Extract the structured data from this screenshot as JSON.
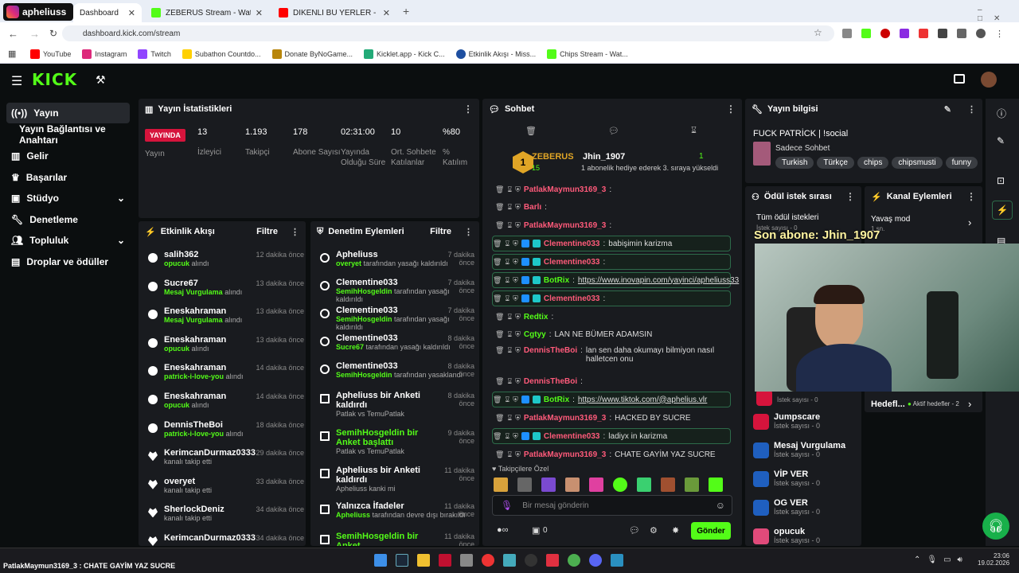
{
  "browser": {
    "tabs": [
      {
        "label": "Dashboard"
      },
      {
        "label": "ZEBERUS Stream - Watch Live o"
      },
      {
        "label": "DİKENLİ BU YERLER - YouTube"
      }
    ],
    "profile_overlay": "apheliuss",
    "url": "dashboard.kick.com/stream",
    "bookmarks": [
      "YouTube",
      "Instagram",
      "Twitch",
      "Subathon Countdo...",
      "Donate ByNoGame...",
      "Kicklet.app - Kick C...",
      "Etkinlik Akışı - Miss...",
      "Chips Stream - Wat..."
    ]
  },
  "sidebar": {
    "items": [
      {
        "label": "Yayın"
      },
      {
        "label": "Yayın Bağlantısı ve Anahtarı"
      },
      {
        "label": "Gelir"
      },
      {
        "label": "Başarılar"
      },
      {
        "label": "Stüdyo"
      },
      {
        "label": "Denetleme"
      },
      {
        "label": "Topluluk"
      },
      {
        "label": "Droplar ve ödüller"
      }
    ]
  },
  "stats": {
    "title": "Yayın İstatistikleri",
    "live_badge": "YAYINDA",
    "live_label": "Yayın",
    "items": [
      {
        "value": "13",
        "label": "İzleyici"
      },
      {
        "value": "1.193",
        "label": "Takipçi"
      },
      {
        "value": "178",
        "label": "Abone Sayısı"
      },
      {
        "value": "02:31:00",
        "label": "Yayında Olduğu Süre"
      },
      {
        "value": "10",
        "label": "Ort. Sohbete Katılanlar"
      },
      {
        "value": "%80",
        "label": "% Katılım"
      }
    ]
  },
  "activity": {
    "title": "Etkinlik Akışı",
    "filter": "Filtre",
    "items": [
      {
        "name": "salih362",
        "sub_hl": "opucuk",
        "sub": " alındı",
        "time": "12 dakika önce"
      },
      {
        "name": "Sucre67",
        "sub_hl": "Mesaj Vurgulama",
        "sub": " alındı",
        "time": "13 dakika önce"
      },
      {
        "name": "Eneskahraman",
        "sub_hl": "Mesaj Vurgulama",
        "sub": " alındı",
        "time": "13 dakika önce"
      },
      {
        "name": "Eneskahraman",
        "sub_hl": "opucuk",
        "sub": " alındı",
        "time": "13 dakika önce"
      },
      {
        "name": "Eneskahraman",
        "sub_hl": "patrick-i-love-you",
        "sub": " alındı",
        "time": "14 dakika önce"
      },
      {
        "name": "Eneskahraman",
        "sub_hl": "opucuk",
        "sub": " alındı",
        "time": "14 dakika önce"
      },
      {
        "name": "DennisTheBoi",
        "sub_hl": "patrick-i-love-you",
        "sub": " alındı",
        "time": "18 dakika önce"
      },
      {
        "name": "KerimcanDurmaz0333",
        "sub_hl": "",
        "sub": "kanalı takip etti",
        "time": "29 dakika önce"
      },
      {
        "name": "overyet",
        "sub_hl": "",
        "sub": "kanalı takip etti",
        "time": "33 dakika önce"
      },
      {
        "name": "SherlockDeniz",
        "sub_hl": "",
        "sub": "kanalı takip etti",
        "time": "34 dakika önce"
      },
      {
        "name": "KerimcanDurmaz0333",
        "sub_hl": "",
        "sub": "",
        "time": "34 dakika önce"
      }
    ]
  },
  "moderation": {
    "title": "Denetim Eylemleri",
    "filter": "Filtre",
    "items": [
      {
        "name": "Apheliuss",
        "sub_hl": "overyet",
        "sub": " tarafından yasağı kaldırıldı",
        "time": "7 dakika önce"
      },
      {
        "name": "Clementine033",
        "sub_hl": "SemihHosgeldin",
        "sub": " tarafından yasağı kaldırıldı",
        "time": "7 dakika önce"
      },
      {
        "name": "Clementine033",
        "sub_hl": "SemihHosgeldin",
        "sub": " tarafından yasağı kaldırıldı",
        "time": "7 dakika önce"
      },
      {
        "name": "Clementine033",
        "sub_hl": "Sucre67",
        "sub": " tarafından yasağı kaldırıldı",
        "time": "8 dakika önce"
      },
      {
        "name": "Clementine033",
        "sub_hl": "SemihHosgeldin",
        "sub": " tarafından yasaklandı",
        "time": "8 dakika önce"
      },
      {
        "name": "Apheliuss bir Anketi kaldırdı",
        "sub_hl": "",
        "sub": "Patlak vs TemuPatlak",
        "time": "8 dakika önce"
      },
      {
        "name": "SemihHosgeldin bir Anket başlattı",
        "sub_hl": "",
        "sub": "Patlak vs TemuPatlak",
        "time": "9 dakika önce"
      },
      {
        "name": "Apheliuss bir Anketi kaldırdı",
        "sub_hl": "",
        "sub": "Apheliuss kanki mi",
        "time": "11 dakika önce"
      },
      {
        "name": "Yalnızca İfadeler",
        "sub_hl": "Apheliuss",
        "sub": " tarafından devre dışı bırakıldı",
        "time": "11 dakika önce"
      },
      {
        "name": "SemihHosgeldin bir Anket",
        "sub_hl": "",
        "sub": "",
        "time": "11 dakika önce"
      }
    ]
  },
  "chat": {
    "title": "Sohbet",
    "pinned_user1": "ZEBERUS",
    "pinned_count1": "15",
    "pinned_user2": "Jhin_1907",
    "pinned_count2": "1",
    "pinned_msg": "1 abonelik hediye ederek 3. sıraya yükseldi",
    "lines": [
      {
        "user": "PatlakMaymun3169_3",
        "color": "#ff5a7a",
        "text": "",
        "hl": false
      },
      {
        "user": "Barlı",
        "color": "#ff5a7a",
        "text": "",
        "hl": false
      },
      {
        "user": "PatlakMaymun3169_3",
        "color": "#ff5a7a",
        "text": "",
        "hl": false
      },
      {
        "user": "Clementine033",
        "color": "#ff5a7a",
        "text": "babişimin karizma",
        "hl": true
      },
      {
        "user": "Clementine033",
        "color": "#ff5a7a",
        "text": "",
        "hl": true
      },
      {
        "user": "BotRix",
        "color": "#53fc18",
        "text": "https://www.inovapin.com/yayinci/apheliuss33",
        "hl": true
      },
      {
        "user": "Clementine033",
        "color": "#ff5a7a",
        "text": "",
        "hl": true
      },
      {
        "user": "Redtix",
        "color": "#53fc18",
        "text": "",
        "hl": false
      },
      {
        "user": "Cgtyy",
        "color": "#53fc18",
        "text": "LAN NE BÜMER ADAMSIN",
        "hl": false
      },
      {
        "user": "DennisTheBoi",
        "color": "#ff5a7a",
        "text": "lan sen daha okumayı bilmiyon nasıl halletcen onu",
        "hl": false
      },
      {
        "user": "DennisTheBoi",
        "color": "#ff5a7a",
        "text": "",
        "hl": false
      },
      {
        "user": "BotRix",
        "color": "#53fc18",
        "text": "https://www.tiktok.com/@aphelius.vlr",
        "hl": true
      },
      {
        "user": "PatlakMaymun3169_3",
        "color": "#ff5a7a",
        "text": "HACKED BY SUCRE",
        "hl": false
      },
      {
        "user": "Clementine033",
        "color": "#ff5a7a",
        "text": "ladiyx in karizma",
        "hl": true
      },
      {
        "user": "PatlakMaymun3169_3",
        "color": "#ff5a7a",
        "text": "CHATE GAYİM YAZ SUCRE",
        "hl": false
      }
    ],
    "follower_only": "Takipçilere Özel",
    "placeholder": "Bir mesaj gönderin",
    "send": "Gönder",
    "count": "0"
  },
  "info": {
    "title": "Yayın bilgisi",
    "stream_title": "FUCK PATRİCK | !social",
    "category": "Sadece Sohbet",
    "tags": [
      "Turkish",
      "Türkçe",
      "chips",
      "chipsmusti",
      "funny"
    ]
  },
  "rewards": {
    "title": "Ödül istek sırası",
    "all": "Tüm ödül istekleri",
    "count_label": "İstek sayısı - 0",
    "items": [
      {
        "name": "Jumpscare"
      },
      {
        "name": "Mesaj Vurgulama"
      },
      {
        "name": "VİP VER"
      },
      {
        "name": "OG VER"
      },
      {
        "name": "opucuk"
      }
    ]
  },
  "channel": {
    "title": "Kanal Eylemleri",
    "slow": "Yavaş mod",
    "slow_sub": "1 sn.",
    "goals": "Hedefl...",
    "active_goals": "Aktif hedefler - 2"
  },
  "overlay": {
    "sub_text": "Son abone: Jhin_1907"
  },
  "taskbar": {
    "ticker": "PatlakMaymun3169_3 : CHATE GAYİM YAZ SUCRE",
    "time": "23:06",
    "date": "19.02.2026"
  }
}
